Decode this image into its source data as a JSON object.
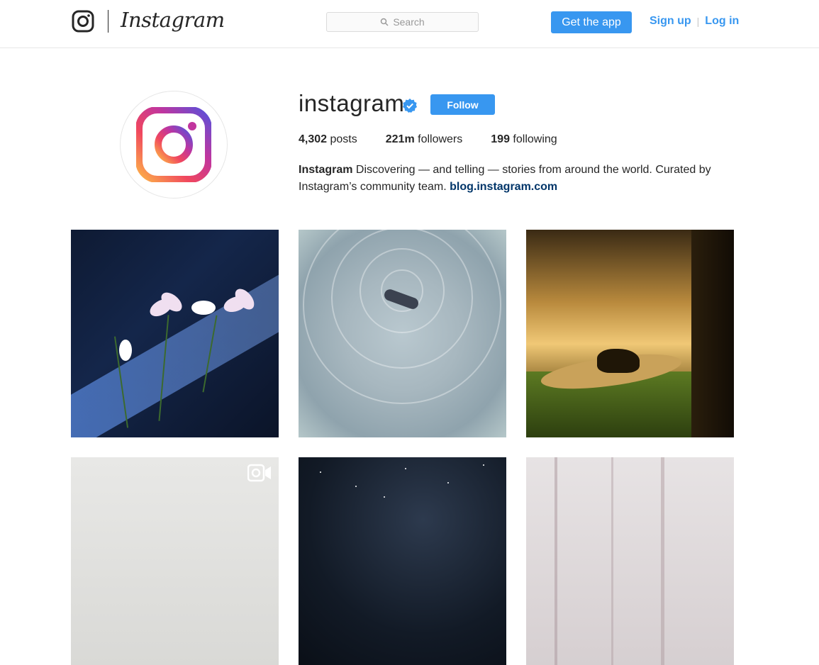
{
  "header": {
    "logo_word": "Instagram",
    "search_placeholder": "Search",
    "get_app_label": "Get the app",
    "signup_label": "Sign up",
    "separator": "|",
    "login_label": "Log in"
  },
  "profile": {
    "username": "instagram",
    "follow_label": "Follow",
    "stats": [
      {
        "value": "4,302",
        "label": "posts"
      },
      {
        "value": "221m",
        "label": "followers"
      },
      {
        "value": "199",
        "label": "following"
      }
    ],
    "bio_name": "Instagram",
    "bio_text": " Discovering — and telling — stories from around the world. Curated by Instagram’s community team. ",
    "bio_link": "blog.instagram.com"
  },
  "colors": {
    "accent": "#3897f0",
    "text": "#262626",
    "link": "#003569"
  },
  "icons": [
    "instagram-glyph-icon",
    "search-icon",
    "verified-badge-icon",
    "video-icon"
  ]
}
